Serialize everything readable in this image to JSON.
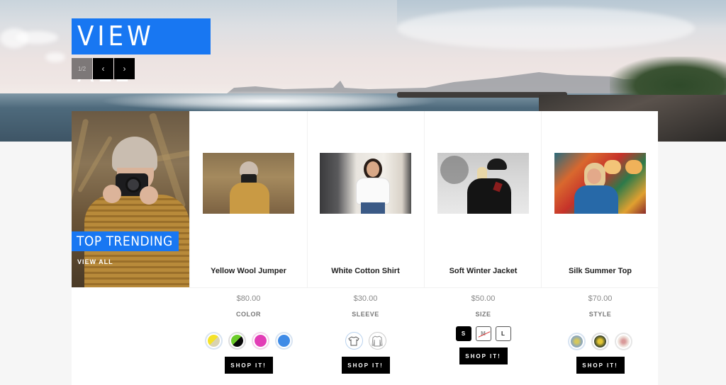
{
  "header": {
    "title": "VIEW ALL",
    "pager": {
      "count": "1/2",
      "prev_icon": "‹",
      "next_icon": "›"
    }
  },
  "feature": {
    "badge": "TOP TRENDING",
    "link": "VIEW ALL"
  },
  "products": [
    {
      "name": "Yellow Wool Jumper",
      "price": "$80.00",
      "attribute": "COLOR",
      "option_type": "color",
      "options": [
        {
          "label": "yellow",
          "colors": [
            "#f4e22a",
            "#d9d3b0"
          ]
        },
        {
          "label": "green-black",
          "colors": [
            "#6ccc2a",
            "#0a0a0a"
          ]
        },
        {
          "label": "pink",
          "colors": [
            "#e23db6",
            "#e23db6"
          ]
        },
        {
          "label": "blue",
          "colors": [
            "#3f8be6",
            "#3f8be6"
          ]
        }
      ],
      "button": "SHOP IT!"
    },
    {
      "name": "White Cotton Shirt",
      "price": "$30.00",
      "attribute": "SLEEVE",
      "option_type": "icon",
      "options": [
        {
          "label": "short-sleeve",
          "icon": "t-shirt-icon",
          "selected": true
        },
        {
          "label": "long-sleeve",
          "icon": "long-sleeve-icon",
          "selected": false
        }
      ],
      "button": "SHOP IT!"
    },
    {
      "name": "Soft Winter Jacket",
      "price": "$50.00",
      "attribute": "SIZE",
      "option_type": "size",
      "options": [
        {
          "label": "S",
          "state": "selected"
        },
        {
          "label": "M",
          "state": "disabled"
        },
        {
          "label": "L",
          "state": "available"
        }
      ],
      "button": "SHOP IT!"
    },
    {
      "name": "Silk Summer Top",
      "price": "$70.00",
      "attribute": "STYLE",
      "option_type": "pattern",
      "options": [
        {
          "label": "blue-floral",
          "colors": [
            "#8fa8b8",
            "#d6c85a"
          ]
        },
        {
          "label": "dark-floral",
          "colors": [
            "#2c3a2a",
            "#e3c634"
          ]
        },
        {
          "label": "white-floral",
          "colors": [
            "#f1e6df",
            "#d99a9a"
          ]
        }
      ],
      "button": "SHOP IT!"
    }
  ],
  "colors": {
    "accent": "#1877f2",
    "button": "#000000",
    "pager_count_bg": "#7d7878"
  }
}
